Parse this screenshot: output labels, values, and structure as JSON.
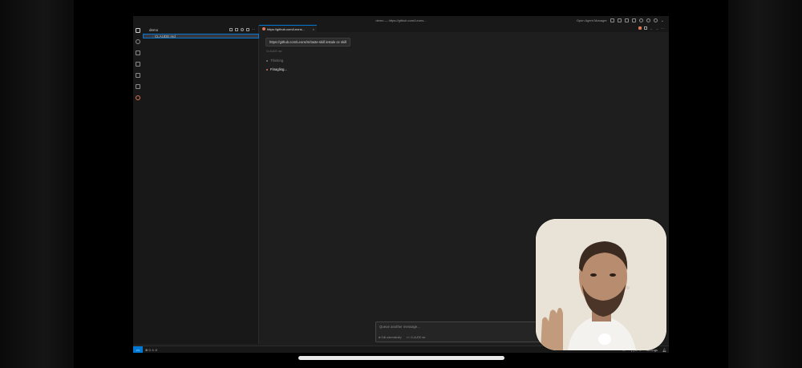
{
  "window": {
    "title": "demo — https://github.com/Leons...",
    "agent_manager_label": "Open Agent Manager"
  },
  "explorer": {
    "header": "demo",
    "files": [
      {
        "name": "CLAUDE.md"
      }
    ]
  },
  "editor": {
    "tab_label": "https://github.com/Leons...",
    "tab_close": "×"
  },
  "agent": {
    "prompt": "https://github.com/Leons/m/taste-skill instale ce skill",
    "context_label": "CLAUDE.md",
    "thinking": "Thinking",
    "status": "Finagling..."
  },
  "chat": {
    "placeholder": "Queue another message...",
    "mode_label": "Edit automatically",
    "context_file": "CLAUDE.md"
  },
  "statusbar": {
    "errors": "0",
    "warnings": "0",
    "remote_icon": "><",
    "right_items": [
      "LF",
      "{ } LPS",
      "Settings"
    ]
  },
  "icons": {
    "activity": [
      "files-icon",
      "search-icon",
      "source-control-icon",
      "run-debug-icon",
      "remote-explorer-icon",
      "extensions-icon",
      "claude-icon"
    ]
  },
  "colors": {
    "accent": "#0078d4",
    "claude": "#d97757",
    "background": "#1e1e1e",
    "sidebar": "#181818"
  }
}
